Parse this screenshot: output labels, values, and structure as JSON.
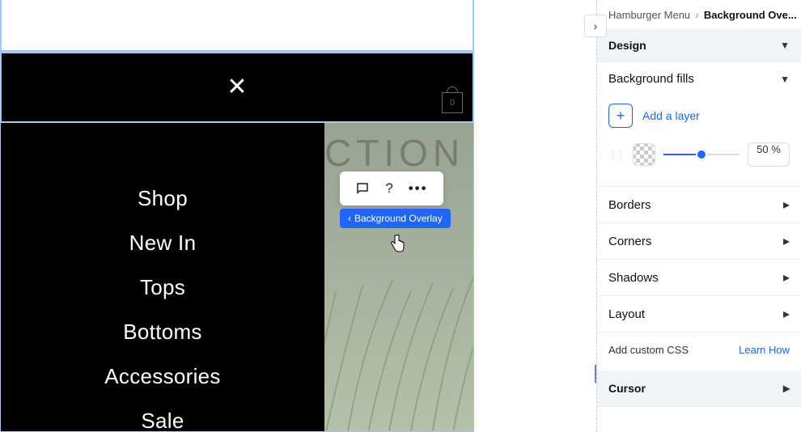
{
  "breadcrumb": {
    "parent": "Hamburger Menu",
    "current": "Background Ove..."
  },
  "panel": {
    "design_header": "Design",
    "background_fills_header": "Background fills",
    "add_layer_label": "Add a layer",
    "opacity_value": "50 %",
    "borders_label": "Borders",
    "corners_label": "Corners",
    "shadows_label": "Shadows",
    "layout_label": "Layout",
    "custom_css_label": "Add custom CSS",
    "learn_how_label": "Learn How",
    "cursor_label": "Cursor"
  },
  "selection": {
    "label": "Background Overlay"
  },
  "preview": {
    "bg_text": "CTION",
    "bag_count": "0",
    "menu_items": [
      "Shop",
      "New In",
      "Tops",
      "Bottoms",
      "Accessories",
      "Sale"
    ]
  },
  "chart_data": null
}
